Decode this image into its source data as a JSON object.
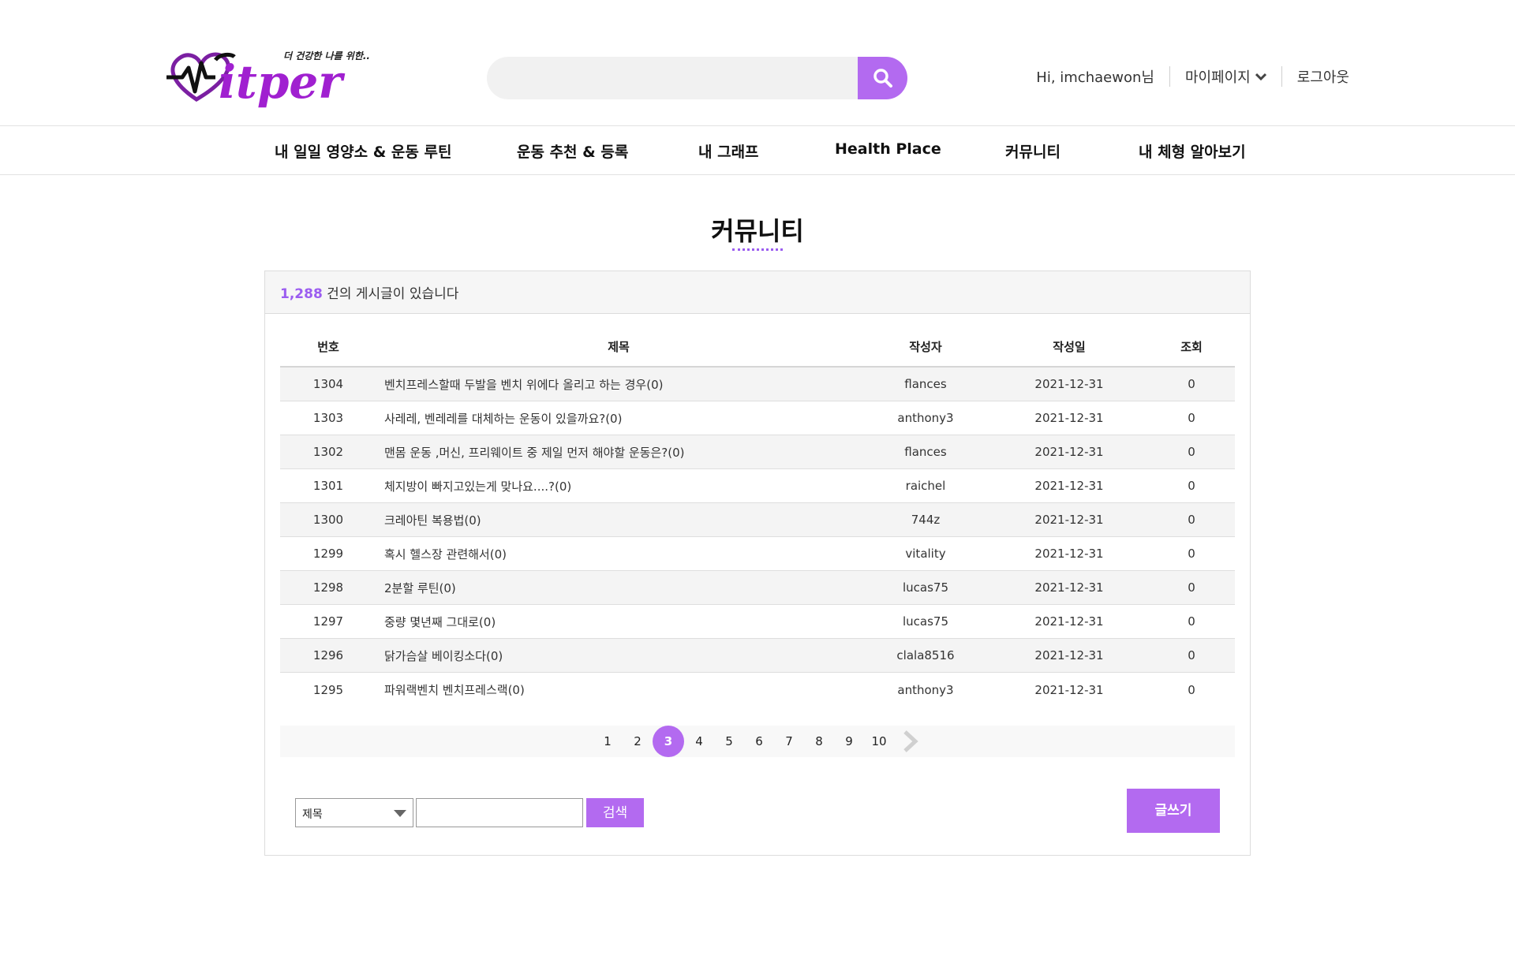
{
  "brand": {
    "logo_text": "Fitper",
    "tagline": "더 건강한 나를 위한..",
    "accent_color": "#b36af0"
  },
  "search": {
    "placeholder": "",
    "icon": "search-icon"
  },
  "user": {
    "greeting": "Hi, imchaewon님",
    "mypage_label": "마이페이지",
    "logout_label": "로그아웃"
  },
  "nav": {
    "items": [
      {
        "label": "내 일일 영양소 & 운동 루틴"
      },
      {
        "label": "운동 추천 & 등록"
      },
      {
        "label": "내 그래프"
      },
      {
        "label": "Health Place"
      },
      {
        "label": "커뮤니티"
      },
      {
        "label": "내 체형 알아보기"
      }
    ]
  },
  "page": {
    "title": "커뮤니티"
  },
  "board": {
    "count": "1,288",
    "count_suffix": " 건의 게시글이 있습니다",
    "columns": {
      "no": "번호",
      "title": "제목",
      "author": "작성자",
      "date": "작성일",
      "views": "조회"
    },
    "rows": [
      {
        "no": "1304",
        "title": "벤치프레스할때 두발을 벤치 위에다 올리고 하는 경우(0)",
        "author": "flances",
        "date": "2021-12-31",
        "views": "0"
      },
      {
        "no": "1303",
        "title": "사레레, 벤레레를 대체하는 운동이 있을까요?(0)",
        "author": "anthony3",
        "date": "2021-12-31",
        "views": "0"
      },
      {
        "no": "1302",
        "title": "맨몸 운동 ,머신, 프리웨이트 중 제일 먼저 해야할 운동은?(0)",
        "author": "flances",
        "date": "2021-12-31",
        "views": "0"
      },
      {
        "no": "1301",
        "title": "체지방이 빠지고있는게 맞나요....?(0)",
        "author": "raichel",
        "date": "2021-12-31",
        "views": "0"
      },
      {
        "no": "1300",
        "title": "크레아틴 복용법(0)",
        "author": "744z",
        "date": "2021-12-31",
        "views": "0"
      },
      {
        "no": "1299",
        "title": "혹시 헬스장 관련해서(0)",
        "author": "vitality",
        "date": "2021-12-31",
        "views": "0"
      },
      {
        "no": "1298",
        "title": "2분할 루틴(0)",
        "author": "lucas75",
        "date": "2021-12-31",
        "views": "0"
      },
      {
        "no": "1297",
        "title": "중량 몇년째 그대로(0)",
        "author": "lucas75",
        "date": "2021-12-31",
        "views": "0"
      },
      {
        "no": "1296",
        "title": "닭가슴살 베이킹소다(0)",
        "author": "clala8516",
        "date": "2021-12-31",
        "views": "0"
      },
      {
        "no": "1295",
        "title": "파워랙벤치 벤치프레스랙(0)",
        "author": "anthony3",
        "date": "2021-12-31",
        "views": "0"
      }
    ],
    "pagination": {
      "pages": [
        "1",
        "2",
        "3",
        "4",
        "5",
        "6",
        "7",
        "8",
        "9",
        "10"
      ],
      "current": "3"
    },
    "search": {
      "field_selected": "제목",
      "keyword_value": "",
      "button_label": "검색"
    },
    "write_label": "글쓰기"
  }
}
